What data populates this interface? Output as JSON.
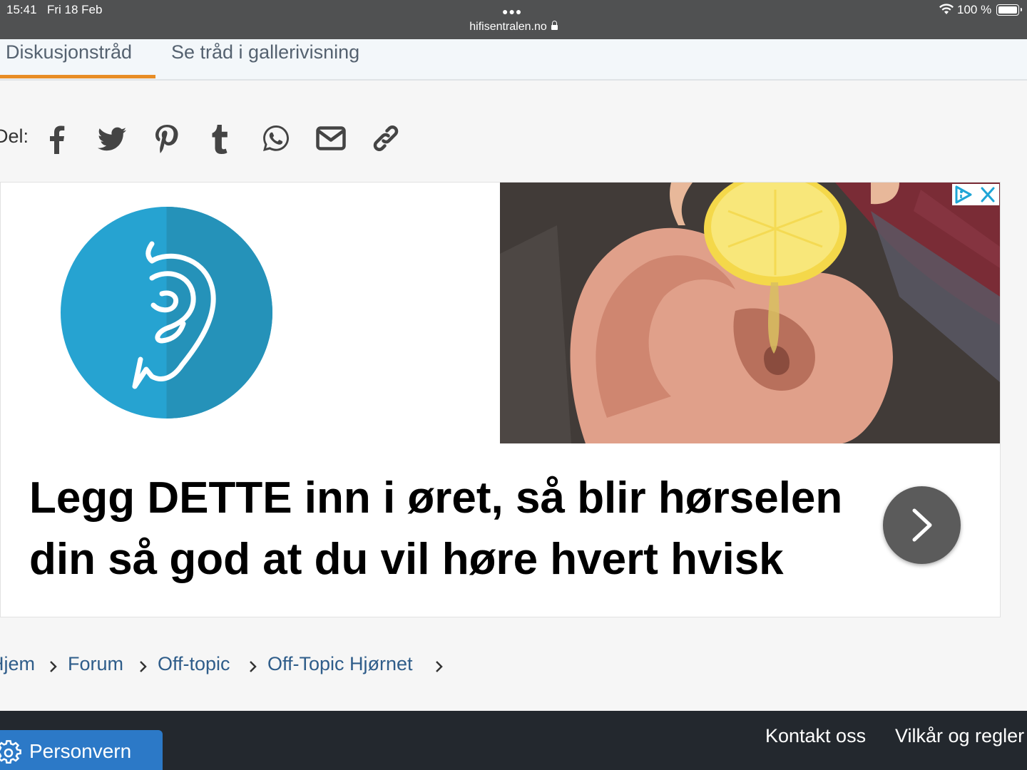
{
  "status_bar": {
    "time": "15:41",
    "date": "Fri 18 Feb",
    "url": "hifisentralen.no",
    "battery": "100 %"
  },
  "tabs": [
    {
      "label": "Diskusjonstråd",
      "active": true
    },
    {
      "label": "Se tråd i gallerivisning",
      "active": false
    }
  ],
  "share": {
    "label": "Del:",
    "icons": [
      "facebook-icon",
      "twitter-icon",
      "pinterest-icon",
      "tumblr-icon",
      "whatsapp-icon",
      "email-icon",
      "link-icon"
    ]
  },
  "ad": {
    "headline": "Legg DETTE inn i øret, så blir hørselen din så god at du vil høre hvert hvisk",
    "logo_color": "#26a3d1",
    "next_icon": "chevron-right-icon"
  },
  "breadcrumb": [
    "Hjem",
    "Forum",
    "Off-topic",
    "Off-Topic Hjørnet"
  ],
  "footer": {
    "links": [
      "Kontakt oss",
      "Vilkår og regler"
    ],
    "privacy_label": "Personvern"
  },
  "colors": {
    "accent": "#e88d26",
    "link": "#2f5d8a",
    "footer_bg": "#23282e",
    "privacy_bg": "#2c79c7"
  }
}
